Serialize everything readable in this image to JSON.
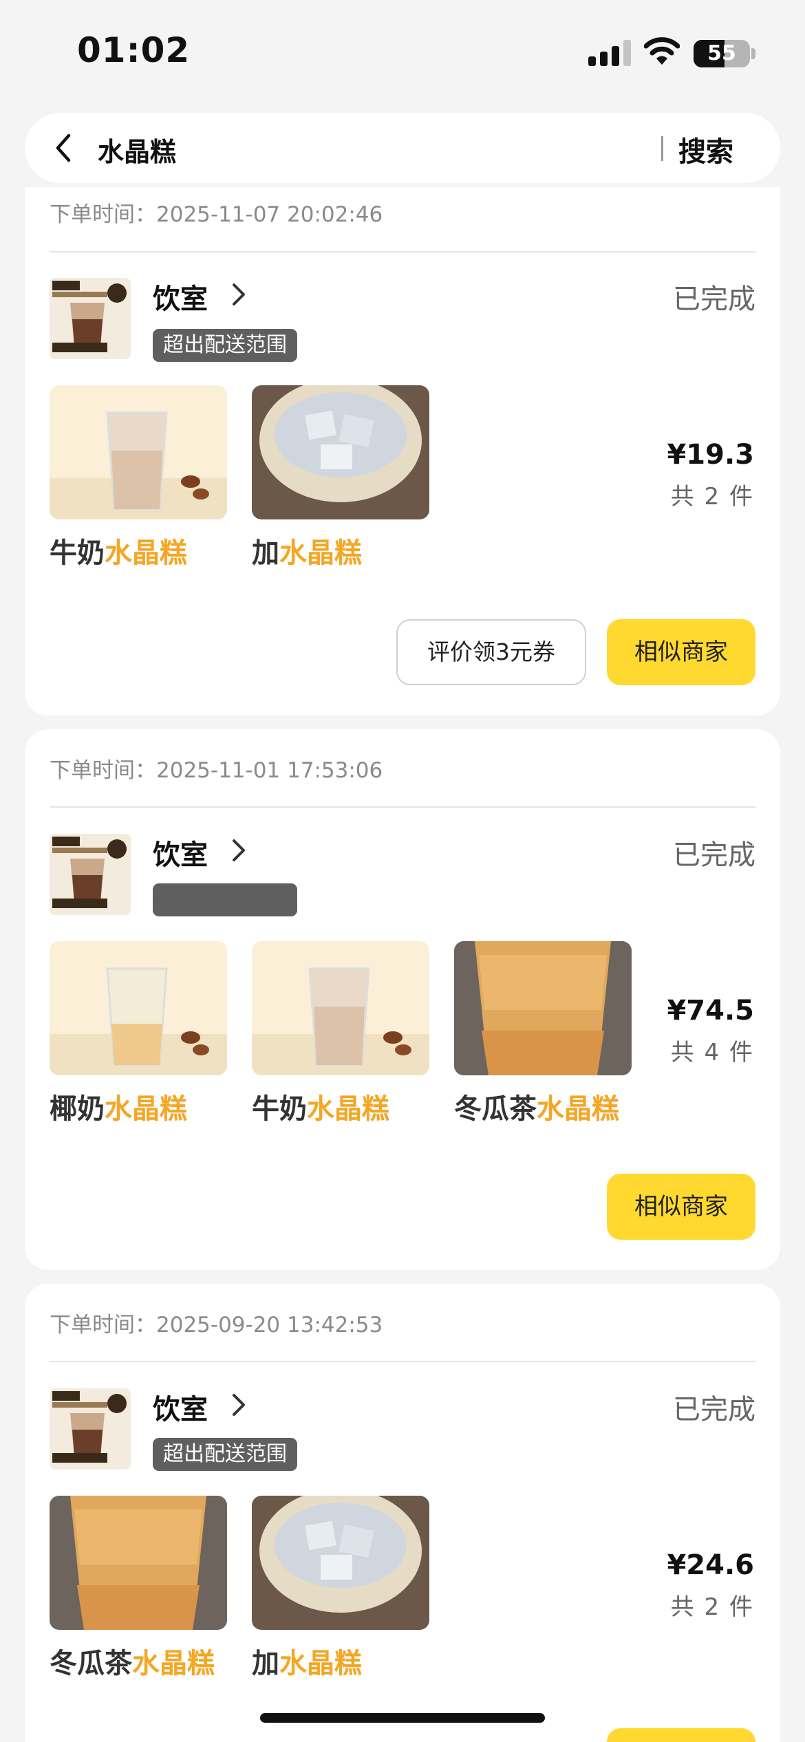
{
  "status_bar": {
    "time": "01:02",
    "battery": "55"
  },
  "search": {
    "query": "水晶糕",
    "button": "搜索"
  },
  "orders": [
    {
      "time_label": "下单时间：2025-11-07 20:02:46",
      "store_name": "饮室",
      "store_tag": "超出配送范围",
      "status": "已完成",
      "items": [
        {
          "prefix": "牛奶",
          "highlight": "水晶糕"
        },
        {
          "prefix": "加",
          "highlight": "水晶糕"
        }
      ],
      "price": "¥19.3",
      "count": "共 2 件",
      "btn_review": "评价领3元券",
      "btn_similar": "相似商家"
    },
    {
      "time_label": "下单时间：2025-11-01 17:53:06",
      "store_name": "饮室",
      "store_tag": "",
      "status": "已完成",
      "items": [
        {
          "prefix": "椰奶",
          "highlight": "水晶糕"
        },
        {
          "prefix": "牛奶",
          "highlight": "水晶糕"
        },
        {
          "prefix": "冬瓜茶",
          "highlight": "水晶糕"
        }
      ],
      "price": "¥74.5",
      "count": "共 4 件",
      "btn_similar": "相似商家"
    },
    {
      "time_label": "下单时间：2025-09-20 13:42:53",
      "store_name": "饮室",
      "store_tag": "超出配送范围",
      "status": "已完成",
      "items": [
        {
          "prefix": "冬瓜茶",
          "highlight": "水晶糕"
        },
        {
          "prefix": "加",
          "highlight": "水晶糕"
        }
      ],
      "price": "¥24.6",
      "count": "共 2 件"
    }
  ],
  "colors": {
    "highlight": "#f5a623",
    "button_yellow": "#ffd930"
  },
  "icons": [
    "back-icon",
    "chevron-right-icon",
    "wifi-icon",
    "signal-icon",
    "battery-icon"
  ]
}
